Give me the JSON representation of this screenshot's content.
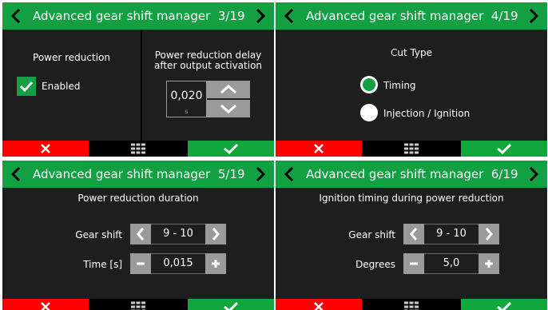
{
  "colors": {
    "header_green": "#13a043",
    "cancel_red": "#ff0000",
    "confirm_green": "#10a83c",
    "button_grey": "#9a9a9a"
  },
  "panels": [
    {
      "title": "Advanced gear shift manager",
      "page": "3/19",
      "left_label": "Power reduction",
      "checkbox_label": "Enabled",
      "checkbox_checked": true,
      "right_label_line1": "Power reduction delay",
      "right_label_line2": "after output activation",
      "delay_value": "0,020",
      "delay_unit": "s"
    },
    {
      "title": "Advanced gear shift manager",
      "page": "4/19",
      "heading": "Cut Type",
      "options": [
        {
          "label": "Timing",
          "selected": true
        },
        {
          "label": "Injection / Ignition",
          "selected": false
        }
      ]
    },
    {
      "title": "Advanced gear shift manager",
      "page": "5/19",
      "heading": "Power reduction duration",
      "row1_label": "Gear shift",
      "row1_value": "9 - 10",
      "row2_label": "Time [s]",
      "row2_value": "0,015"
    },
    {
      "title": "Advanced gear shift manager",
      "page": "6/19",
      "heading": "Ignition timing during power reduction",
      "row1_label": "Gear shift",
      "row1_value": "9 - 10",
      "row2_label": "Degrees",
      "row2_value": "5,0"
    }
  ],
  "icons": {
    "prev": "chevron-left-icon",
    "next": "chevron-right-icon",
    "cancel": "close-icon",
    "menu": "grid-menu-icon",
    "confirm": "check-icon"
  }
}
